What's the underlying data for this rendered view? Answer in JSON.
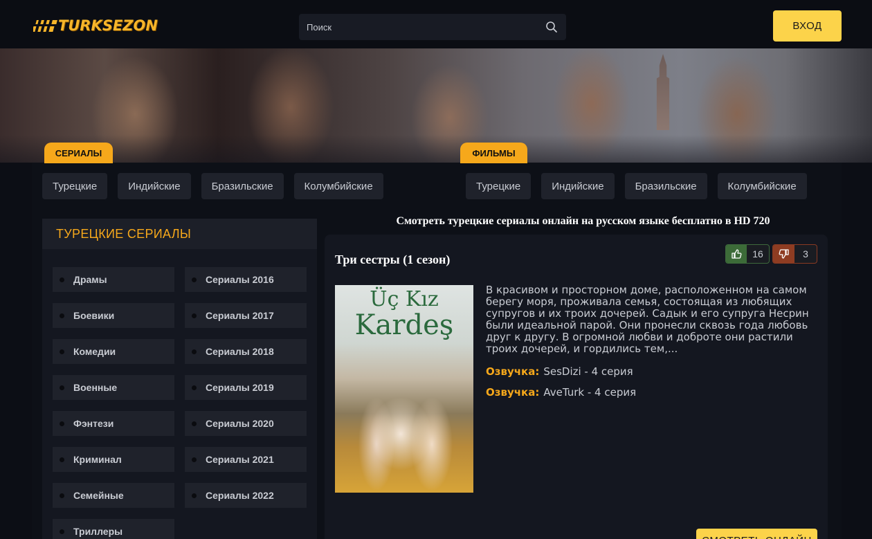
{
  "header": {
    "logo_text": "TURKSEZON",
    "search_placeholder": "Поиск",
    "login_label": "ВХОД"
  },
  "sections": {
    "serials_tab": "СЕРИАЛЫ",
    "films_tab": "ФИЛЬМЫ"
  },
  "serial_categories": [
    "Турецкие",
    "Индийские",
    "Бразильские",
    "Колумбийские"
  ],
  "film_categories": [
    "Турецкие",
    "Индийские",
    "Бразильские",
    "Колумбийские"
  ],
  "sidebar": {
    "title": "ТУРЕЦКИЕ СЕРИАЛЫ",
    "genres": [
      "Драмы",
      "Сериалы 2016",
      "Боевики",
      "Сериалы 2017",
      "Комедии",
      "Сериалы 2018",
      "Военные",
      "Сериалы 2019",
      "Фэнтези",
      "Сериалы 2020",
      "Криминал",
      "Сериалы 2021",
      "Семейные",
      "Сериалы 2022",
      "Триллеры"
    ]
  },
  "content": {
    "heading": "Смотреть турецкие сериалы онлайн на русском языке бесплатно в HD 720",
    "card": {
      "title": "Три сестры (1 сезон)",
      "likes": "16",
      "dislikes": "3",
      "poster_title_line1": "Üç Kız",
      "poster_title_line2": "Kardeş",
      "description": "В красивом и просторном доме, расположенном на самом берегу моря, проживала семья, состоящая из любящих супругов и их троих дочерей. Садык и его супруга Несрин были идеальной парой. Они пронесли сквозь года любовь друг к другу. В огромной любви и доброте они растили троих дочерей, и гордились тем,...",
      "voice_label_1": "Озвучка:",
      "voice_value_1": "SesDizi - 4 серия",
      "voice_label_2": "Озвучка:",
      "voice_value_2": "AveTurk - 4 серия",
      "watch_label": "СМОТРЕТЬ ОНЛАЙН"
    }
  },
  "colors": {
    "accent_orange": "#f6a81b",
    "accent_yellow": "#fcd34a",
    "like_green": "#3c6b38",
    "dislike_red": "#8e3c22",
    "background": "#0c0e15"
  },
  "icons": {
    "search": "search-icon",
    "like": "thumbs-up-icon",
    "dislike": "thumbs-down-icon",
    "logo": "clapperboard-icon"
  }
}
